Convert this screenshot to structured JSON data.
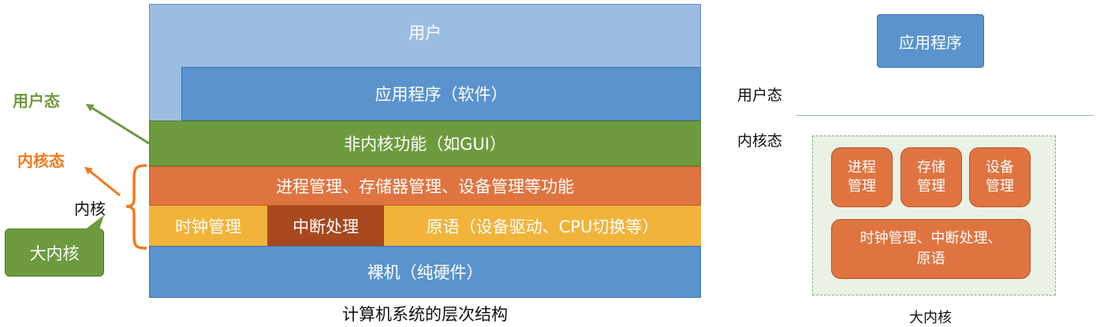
{
  "left": {
    "layers": {
      "user": "用户",
      "apps": "应用程序（软件）",
      "non_kernel": "非内核功能（如GUI）",
      "mgmt": "进程管理、存储器管理、设备管理等功能",
      "clock": "时钟管理",
      "interrupt": "中断处理",
      "primitives": "原语（设备驱动、CPU切换等）",
      "bare": "裸机（纯硬件）"
    },
    "caption": "计算机系统的层次结构",
    "annotations": {
      "user_mode": "用户态",
      "kernel_mode": "内核态",
      "kernel": "内核",
      "callout": "大内核"
    }
  },
  "right": {
    "app": "应用程序",
    "user_mode": "用户态",
    "kernel_mode": "内核态",
    "modules": [
      "进程\n管理",
      "存储\n管理",
      "设备\n管理"
    ],
    "bottom_module": "时钟管理、中断处理、\n原语",
    "caption": "大内核"
  },
  "colors": {
    "user_layer": "#9cbde2",
    "blue_layer": "#5a93cd",
    "green_layer": "#6d9b3e",
    "orange_layer": "#e07440",
    "yellow_layer": "#f2b33a",
    "dark_orange": "#a8481f",
    "user_mode_text": "#6d9b3e",
    "kernel_mode_text": "#f07a1e",
    "callout_fill": "#6d9b3e",
    "module_fill": "#e07440",
    "dashed_box_fill": "#eaf1e6"
  }
}
